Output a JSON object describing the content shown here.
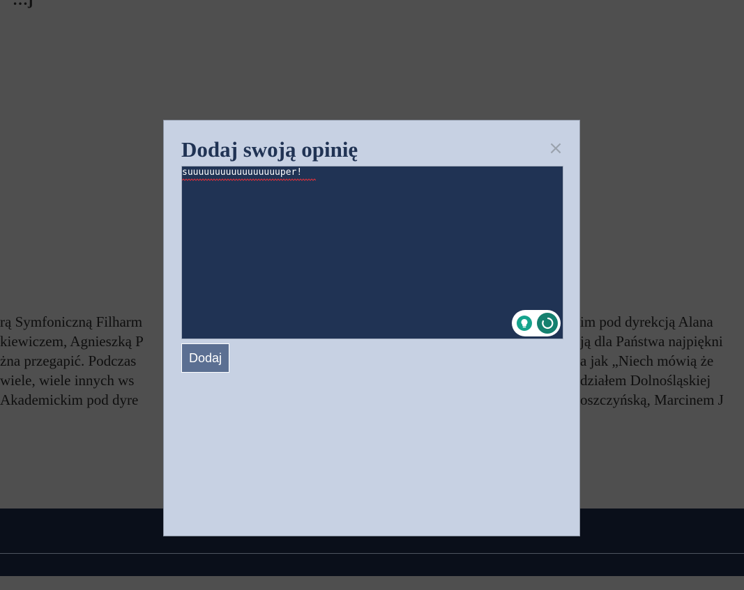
{
  "page": {
    "background_heading": "…j",
    "article_lines": [
      "rą Symfoniczną Filharm",
      "kiewiczem, Agnieszką P",
      "żna przegapić. Podczas",
      " wiele, wiele innych ws",
      " Akademickim pod dyre",
      "im pod dyrekcją Alana",
      "ją dla Państwa najpiękni",
      "a jak „Niech mówią że",
      "działem Dolnośląskiej",
      "oszczyńską, Marcinem J"
    ]
  },
  "modal": {
    "title": "Dodaj swoją opinię",
    "close_symbol": "×",
    "opinion_value": "suuuuuuuuuuuuuuuuuper!",
    "add_button_label": "Dodaj"
  },
  "assist_widget": {
    "icons": [
      "lightbulb-icon",
      "assistant-status-icon"
    ],
    "colors": {
      "bulb": "#15a38c",
      "status": "#15806f"
    }
  },
  "colors": {
    "overlay": "#4f4f4f",
    "modal_bg": "#c7d1e3",
    "title": "#203354",
    "textarea_bg": "#203354",
    "button_bg": "#5b6f92",
    "footer_bg": "#0a0f1a"
  }
}
